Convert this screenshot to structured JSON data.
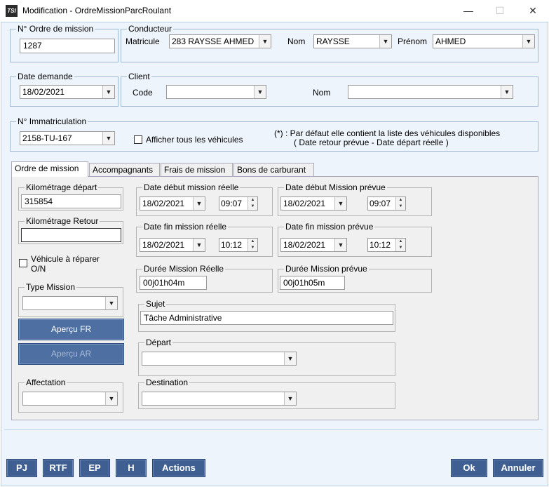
{
  "window": {
    "app_icon_text": "TSI",
    "title": "Modification - OrdreMissionParcRoulant",
    "minimize": "—",
    "maximize": "☐",
    "close": "✕"
  },
  "ordre": {
    "legend": "N° Ordre de mission",
    "value": "1287"
  },
  "conducteur": {
    "legend": "Conducteur",
    "matricule_label": "Matricule",
    "matricule_value": "283 RAYSSE AHMED",
    "nom_label": "Nom",
    "nom_value": "RAYSSE",
    "prenom_label": "Prénom",
    "prenom_value": "AHMED"
  },
  "date_demande": {
    "legend": "Date demande",
    "value": "18/02/2021"
  },
  "client": {
    "legend": "Client",
    "code_label": "Code",
    "code_value": "",
    "nom_label": "Nom",
    "nom_value": ""
  },
  "immatriculation": {
    "legend": "N° Immatriculation",
    "value": "2158-TU-167",
    "checkbox_label": "Afficher tous les véhicules",
    "note_line1": "(*) : Par défaut elle contient la liste des véhicules disponibles",
    "note_line2": "( Date retour prévue - Date départ réelle )"
  },
  "tabs": [
    {
      "label": "Ordre de mission"
    },
    {
      "label": "Accompagnants"
    },
    {
      "label": "Frais de mission"
    },
    {
      "label": "Bons de carburant"
    }
  ],
  "mission": {
    "km_depart_legend": "Kilométrage départ",
    "km_depart_value": "315854",
    "km_retour_legend": "Kilométrage Retour",
    "km_retour_value": "",
    "vehicule_reparer_label": "Véhicule à réparer O/N",
    "type_mission_legend": "Type Mission",
    "type_mission_value": "",
    "apercu_fr": "Aperçu FR",
    "apercu_ar": "Aperçu AR",
    "affectation_legend": "Affectation",
    "affectation_value": "",
    "date_debut_reelle_legend": "Date début mission réelle",
    "date_debut_reelle": "18/02/2021",
    "heure_debut_reelle": "09:07",
    "date_debut_prevue_legend": "Date début Mission prévue",
    "date_debut_prevue": "18/02/2021",
    "heure_debut_prevue": "09:07",
    "date_fin_reelle_legend": "Date fin mission réelle",
    "date_fin_reelle": "18/02/2021",
    "heure_fin_reelle": "10:12",
    "date_fin_prevue_legend": "Date fin mission prévue",
    "date_fin_prevue": "18/02/2021",
    "heure_fin_prevue": "10:12",
    "duree_reelle_legend": "Durée Mission Réelle",
    "duree_reelle": "00j01h04m",
    "duree_prevue_legend": "Durée Mission prévue",
    "duree_prevue": "00j01h05m",
    "sujet_legend": "Sujet",
    "sujet_value": "Tâche Administrative",
    "depart_legend": "Départ",
    "depart_value": "",
    "destination_legend": "Destination",
    "destination_value": ""
  },
  "footer": {
    "pj": "PJ",
    "rtf": "RTF",
    "ep": "EP",
    "h": "H",
    "actions": "Actions",
    "ok": "Ok",
    "annuler": "Annuler"
  },
  "icons": {
    "dropdown": "▼",
    "spin_up": "▲",
    "spin_down": "▼"
  },
  "colors": {
    "button_blue": "#4d6fa2",
    "footer_blue": "#3f5f93",
    "background": "#eef4fb"
  }
}
